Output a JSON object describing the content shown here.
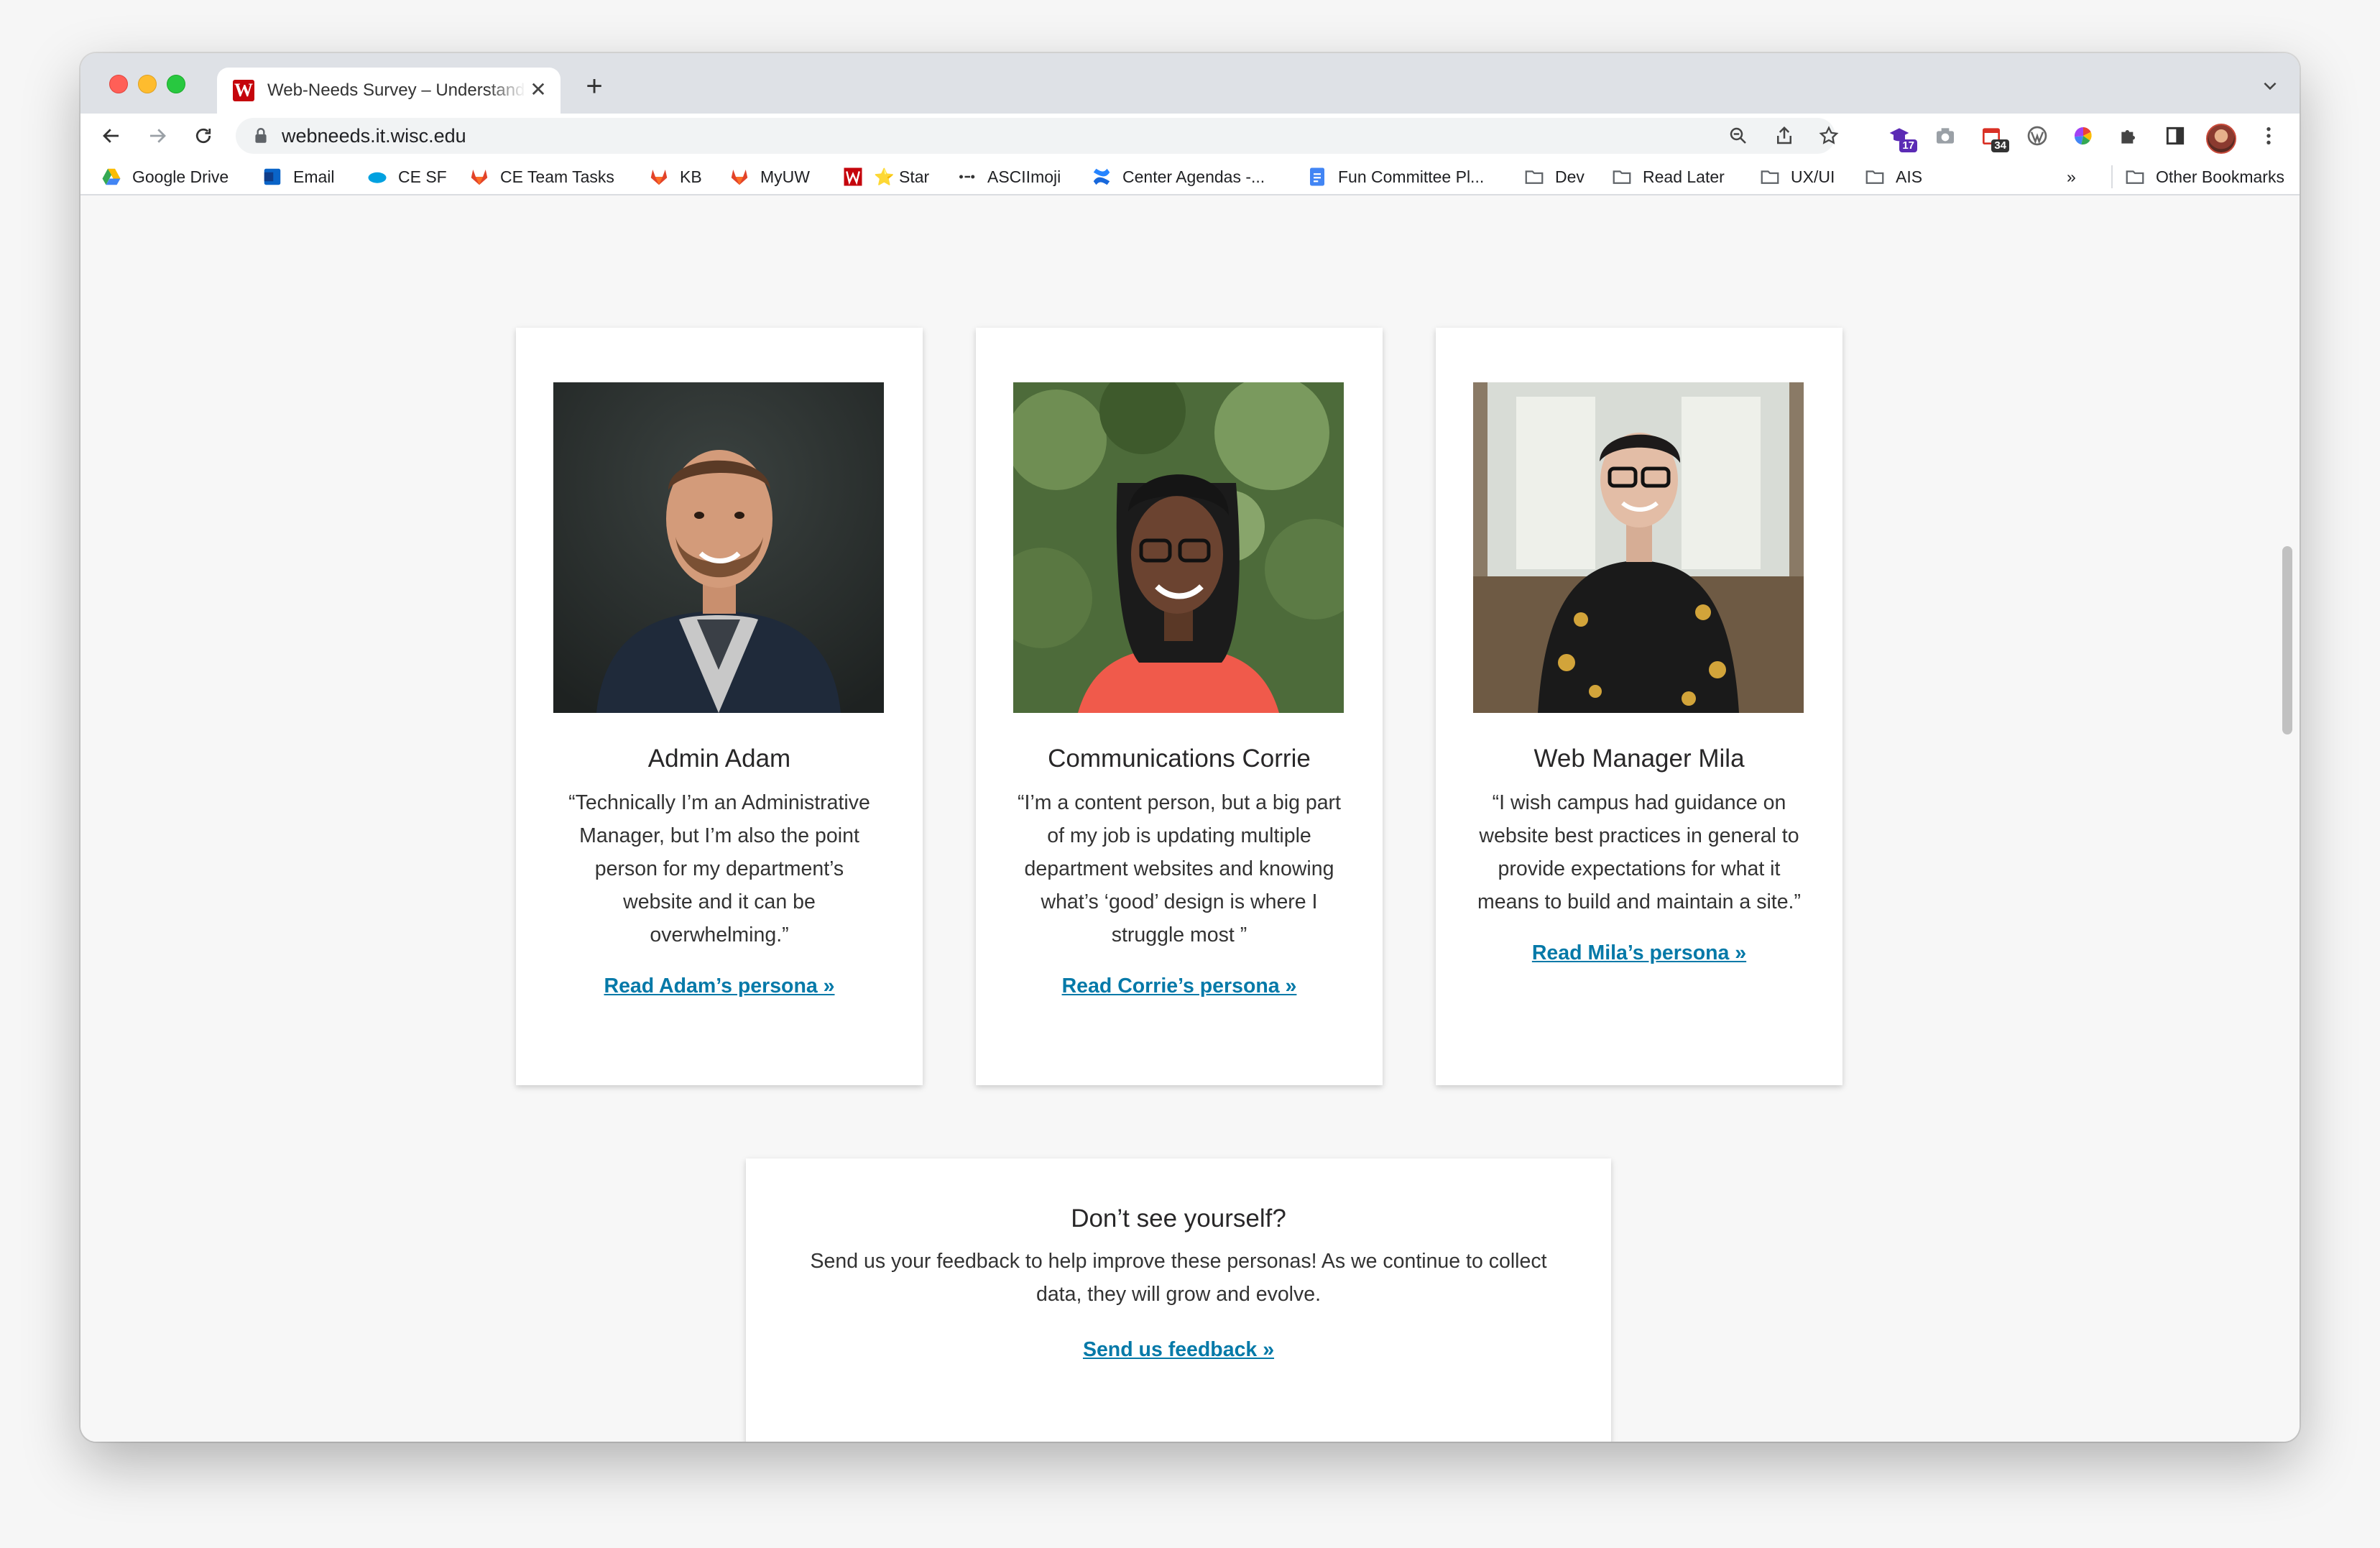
{
  "browser": {
    "tab": {
      "title": "Web-Needs Survey – Understanding Our Users",
      "favicon": "W"
    },
    "url": "webneeds.it.wisc.edu",
    "extensions": [
      {
        "icon": "graduation-cap-icon",
        "badge": "17",
        "color": "#5b2bb5"
      },
      {
        "icon": "camera-icon"
      },
      {
        "icon": "calendar-icon",
        "badge": "34",
        "color": "#d93025"
      },
      {
        "icon": "wordpress-icon"
      },
      {
        "icon": "color-wheel-icon"
      },
      {
        "icon": "puzzle-icon"
      },
      {
        "icon": "side-panel-icon"
      }
    ],
    "bookmarks": [
      {
        "label": "Google Drive",
        "icon": "google-drive-icon"
      },
      {
        "label": "Email",
        "icon": "outlook-icon"
      },
      {
        "label": "CE SF",
        "icon": "salesforce-icon"
      },
      {
        "label": "CE Team Tasks",
        "icon": "gitlab-icon"
      },
      {
        "label": "KB",
        "icon": "gitlab-icon"
      },
      {
        "label": "MyUW",
        "icon": "gitlab-icon"
      },
      {
        "label": "⭐ Star",
        "icon": "uw-icon"
      },
      {
        "label": "ASCIImoji",
        "icon": "asciimoji-icon"
      },
      {
        "label": "Center Agendas -...",
        "icon": "confluence-icon"
      },
      {
        "label": "Fun Committee Pl...",
        "icon": "google-docs-icon"
      },
      {
        "label": "Dev",
        "icon": "folder-icon"
      },
      {
        "label": "Read Later",
        "icon": "folder-icon"
      },
      {
        "label": "UX/UI",
        "icon": "folder-icon"
      },
      {
        "label": "AIS",
        "icon": "folder-icon"
      }
    ],
    "overflow_label": "»",
    "other_bookmarks": "Other Bookmarks"
  },
  "personas": [
    {
      "name": "Admin Adam",
      "quote": "“Technically I’m an Administrative Manager, but I’m also the point person for my department’s website and it can be overwhelming.”",
      "link": "Read Adam’s persona »"
    },
    {
      "name": "Communications Corrie",
      "quote": "“I’m a content person, but a big part of my job is updating multiple department websites and knowing what’s ‘good’ design is where I struggle most ”",
      "link": "Read Corrie’s persona »"
    },
    {
      "name": "Web Manager Mila",
      "quote": "“I wish campus had guidance on website best practices in general to provide expectations for what it means to build and maintain a site.”",
      "link": "Read Mila’s persona »"
    }
  ],
  "feedback": {
    "title": "Don’t see yourself?",
    "text": "Send us your feedback to help improve these personas! As we continue to collect data, they will grow and evolve.",
    "link": "Send us feedback »"
  },
  "colors": {
    "link": "#0479a8",
    "uw_red": "#c5050c"
  }
}
